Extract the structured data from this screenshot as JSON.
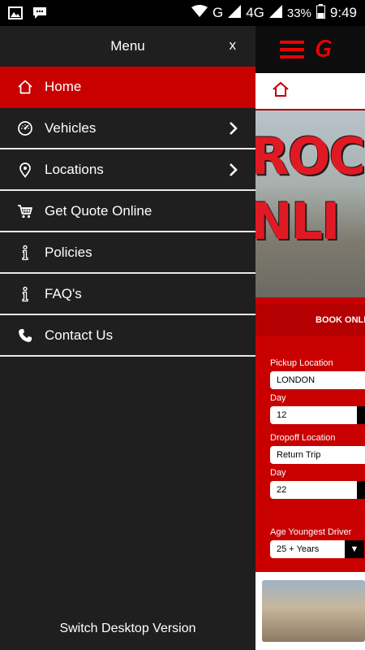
{
  "status_bar": {
    "network": "G",
    "network2": "4G",
    "battery": "33%",
    "time": "9:49"
  },
  "drawer": {
    "title": "Menu",
    "close_label": "x",
    "items": [
      {
        "label": "Home",
        "icon": "home-icon"
      },
      {
        "label": "Vehicles",
        "icon": "speedometer-icon"
      },
      {
        "label": "Locations",
        "icon": "location-pin-icon"
      },
      {
        "label": "Get Quote Online",
        "icon": "cart-icon"
      },
      {
        "label": "Policies",
        "icon": "info-icon"
      },
      {
        "label": "FAQ's",
        "icon": "info-icon"
      },
      {
        "label": "Contact Us",
        "icon": "phone-icon"
      }
    ],
    "footer_link": "Switch Desktop Version"
  },
  "background_page": {
    "hero_line1": "ROC",
    "hero_line2": "NLI",
    "book_label": "BOOK ONLIN",
    "form": {
      "pickup_label": "Pickup Location",
      "pickup_value": "LONDON",
      "pickup_day_label": "Day",
      "pickup_day_value": "12",
      "dropoff_label": "Dropoff Location",
      "dropoff_value": "Return Trip",
      "dropoff_day_label": "Day",
      "dropoff_day_value": "22",
      "age_label": "Age Youngest Driver",
      "age_value": "25 + Years"
    }
  },
  "colors": {
    "accent": "#c80000",
    "drawer_bg": "#1f1f1f",
    "divider": "#e8e8e8"
  }
}
